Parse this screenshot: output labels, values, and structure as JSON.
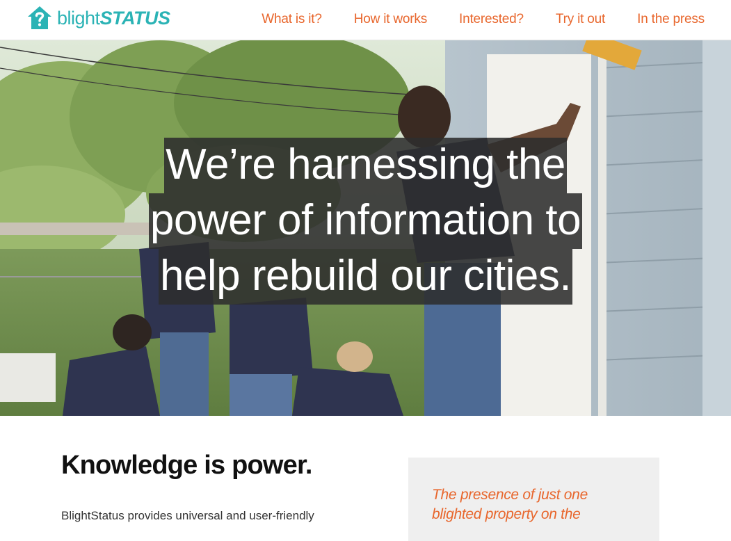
{
  "brand": {
    "name_light": "blight",
    "name_bold": "STATUS",
    "accent": "#2bb3b5"
  },
  "nav": {
    "color": "#e8662c",
    "items": [
      {
        "label": "What is it?"
      },
      {
        "label": "How it works"
      },
      {
        "label": "Interested?"
      },
      {
        "label": "Try it out"
      },
      {
        "label": "In the press"
      }
    ]
  },
  "hero": {
    "lines": [
      "We’re harnessing the",
      "power of information to",
      "help rebuild our cities."
    ]
  },
  "content": {
    "title": "Knowledge is power.",
    "body": "BlightStatus provides universal and user-friendly",
    "quote": "The presence of just one blighted property on the"
  }
}
